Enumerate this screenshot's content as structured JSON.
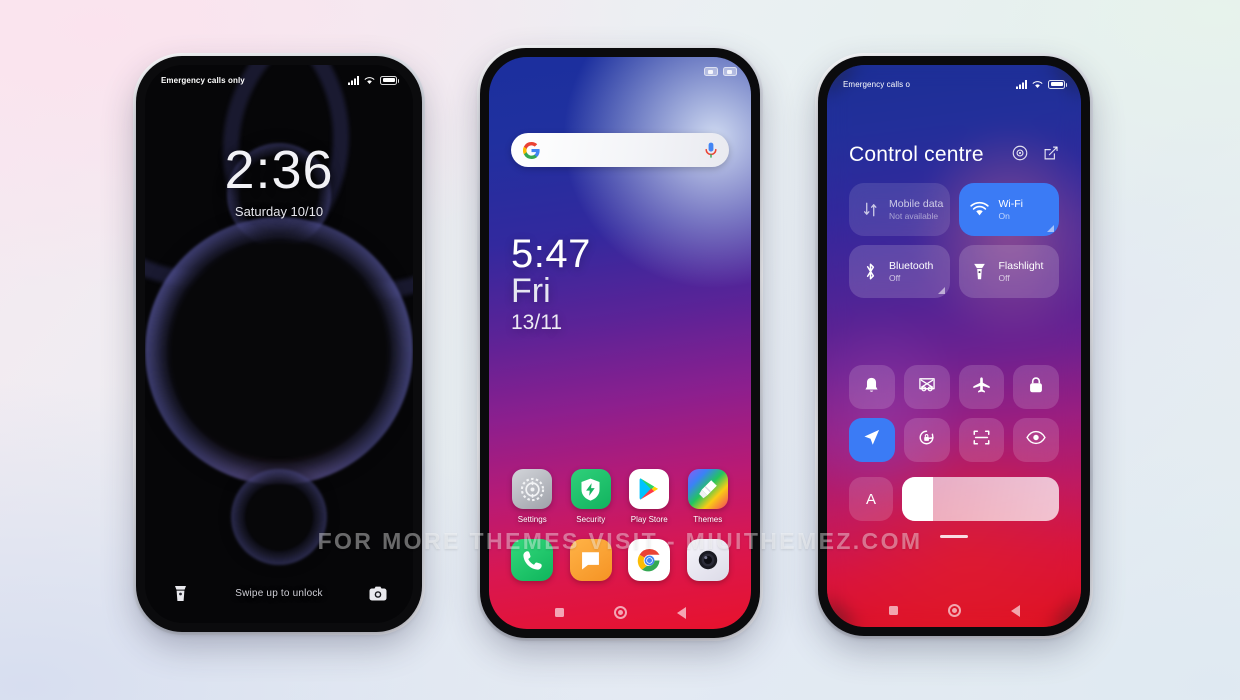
{
  "watermark": "FOR MORE THEMES VISIT - MIUITHEMEZ.COM",
  "colors": {
    "accent_blue": "#3b7bf5",
    "home_gradient_start": "#1b2f9e",
    "home_gradient_end": "#e8122c",
    "lock_background": "#060608"
  },
  "lock_screen": {
    "status": {
      "carrier": "Emergency calls only"
    },
    "time": "2:36",
    "date": "Saturday 10/10",
    "hint": "Swipe up to unlock",
    "left_shortcut_icon": "flashlight-icon",
    "right_shortcut_icon": "camera-icon"
  },
  "home_screen": {
    "search": {
      "placeholder": "",
      "left_icon": "google-g-icon",
      "right_icon": "microphone-icon"
    },
    "time": "5:47",
    "day": "Fri",
    "date": "13/11",
    "apps": [
      {
        "label": "Settings",
        "icon": "settings-gear-icon"
      },
      {
        "label": "Security",
        "icon": "security-shield-icon"
      },
      {
        "label": "Play Store",
        "icon": "play-store-icon"
      },
      {
        "label": "Themes",
        "icon": "themes-brush-icon"
      }
    ],
    "dock": [
      {
        "label": "Phone",
        "icon": "phone-icon"
      },
      {
        "label": "Messages",
        "icon": "messages-icon"
      },
      {
        "label": "Chrome",
        "icon": "chrome-icon"
      },
      {
        "label": "Camera",
        "icon": "camera-lens-icon"
      }
    ],
    "navbar": [
      "recents",
      "home",
      "back"
    ]
  },
  "control_centre": {
    "status": {
      "carrier": "Emergency calls o"
    },
    "title": "Control centre",
    "header_icons": [
      "settings-circle-icon",
      "edit-icon"
    ],
    "big_tiles": [
      {
        "name": "Mobile data",
        "sub": "Not available",
        "state": "off",
        "icon": "mobile-data-icon",
        "expandable": false
      },
      {
        "name": "Wi-Fi",
        "sub": "On",
        "state": "on",
        "icon": "wifi-icon",
        "expandable": true
      },
      {
        "name": "Bluetooth",
        "sub": "Off",
        "state": "off",
        "icon": "bluetooth-icon",
        "expandable": true
      },
      {
        "name": "Flashlight",
        "sub": "Off",
        "state": "off",
        "icon": "flashlight-icon",
        "expandable": false
      }
    ],
    "small_tiles": [
      {
        "name": "silent-bell-icon",
        "state": "off"
      },
      {
        "name": "screenshot-icon",
        "state": "off"
      },
      {
        "name": "airplane-mode-icon",
        "state": "off"
      },
      {
        "name": "lock-icon",
        "state": "off"
      },
      {
        "name": "location-icon",
        "state": "on"
      },
      {
        "name": "auto-rotate-lock-icon",
        "state": "off"
      },
      {
        "name": "scan-icon",
        "state": "off"
      },
      {
        "name": "reading-mode-eye-icon",
        "state": "off"
      }
    ],
    "brightness": {
      "auto_label": "A",
      "level_percent": 20
    },
    "navbar": [
      "recents",
      "home",
      "back"
    ]
  }
}
